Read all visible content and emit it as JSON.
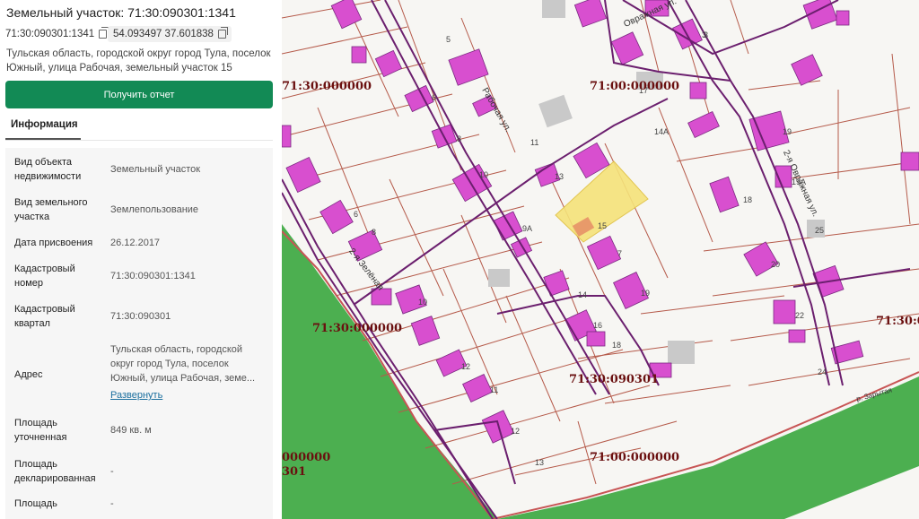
{
  "panel": {
    "title": "Земельный участок: 71:30:090301:1341",
    "chip_cadastral": "71:30:090301:1341",
    "chip_coords": "54.093497 37.601838",
    "address_top": "Тульская область, городской округ город Тула, поселок Южный, улица Рабочая, земельный участок 15",
    "report_button": "Получить отчет",
    "tab_info": "Информация",
    "rows": [
      {
        "label": "Вид объекта недвижимости",
        "value": "Земельный участок"
      },
      {
        "label": "Вид земельного участка",
        "value": "Землепользование"
      },
      {
        "label": "Дата присвоения",
        "value": "26.12.2017"
      },
      {
        "label": "Кадастровый номер",
        "value": "71:30:090301:1341"
      },
      {
        "label": "Кадастровый квартал",
        "value": "71:30:090301"
      },
      {
        "label": "Адрес",
        "value": "Тульская область, городской округ город Тула, поселок Южный, улица Рабочая, земе...",
        "link": "Развернуть"
      },
      {
        "label": "Площадь уточненная",
        "value": "849 кв. м"
      },
      {
        "label": "Площадь декларированная",
        "value": "-"
      },
      {
        "label": "Площадь",
        "value": "-"
      }
    ]
  },
  "map": {
    "quarter_labels": [
      "71:00:000000",
      "71:30:000000",
      "71:30:090301",
      "71:00:000000",
      "71:30:000000",
      "71:30:0",
      "000000",
      "301"
    ],
    "street_labels": [
      "Рабочая ул.",
      "Овражная ул.",
      "2-я Овражная ул.",
      "2-я Зелёная",
      "р. Зарытая"
    ],
    "parcel_numbers": [
      "5",
      "6",
      "8",
      "10",
      "11",
      "13",
      "15",
      "7",
      "9А",
      "14",
      "16",
      "18",
      "14А",
      "19",
      "19А",
      "18",
      "25",
      "20",
      "22",
      "24",
      "3",
      "12",
      "11",
      "12",
      "13",
      "6",
      "8",
      "10",
      "17",
      "19",
      "3"
    ],
    "colors": {
      "building": "#d84fcf",
      "parcel_line": "#b55a4a",
      "quarter_line": "#6b1f6e",
      "selected": "#f5e37a",
      "green": "#4caf50",
      "river_line": "#c75555"
    }
  }
}
